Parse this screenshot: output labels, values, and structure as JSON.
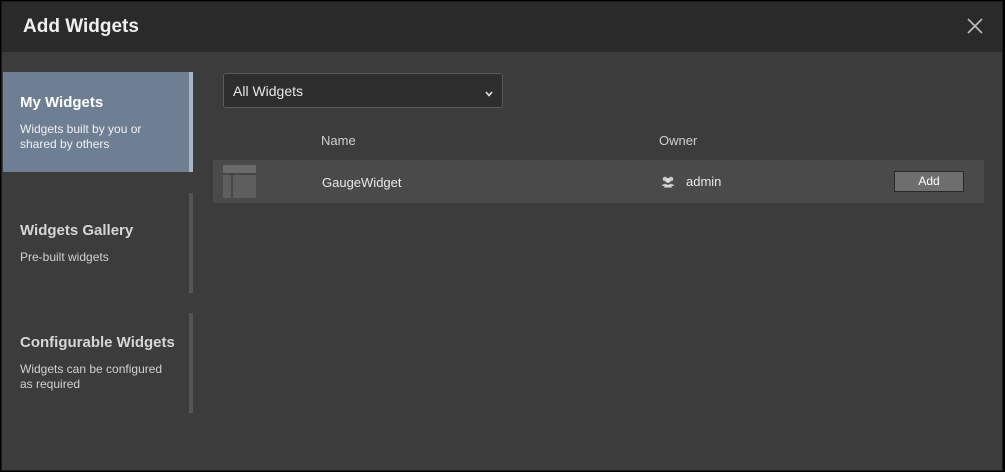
{
  "dialog": {
    "title": "Add Widgets",
    "close_icon": "close-icon"
  },
  "sidebar": {
    "items": [
      {
        "title": "My Widgets",
        "description": "Widgets built by you or shared by others",
        "active": true
      },
      {
        "title": "Widgets Gallery",
        "description": "Pre-built widgets",
        "active": false
      },
      {
        "title": "Configurable Widgets",
        "description": "Widgets can be configured as required",
        "active": false
      }
    ]
  },
  "filter": {
    "selected": "All Widgets",
    "icon": "chevron-down-icon"
  },
  "table": {
    "columns": {
      "name": "Name",
      "owner": "Owner"
    },
    "rows": [
      {
        "thumbnail_icon": "widget-thumbnail-icon",
        "name": "GaugeWidget",
        "owner_icon": "users-icon",
        "owner": "admin",
        "action": "Add"
      }
    ]
  },
  "colors": {
    "header_bg": "#2a2a2a",
    "panel_bg": "#3c3c3c",
    "active_item_bg": "#6f7f93",
    "row_bg": "#4a4a4a",
    "button_bg": "#6e6e6e"
  }
}
